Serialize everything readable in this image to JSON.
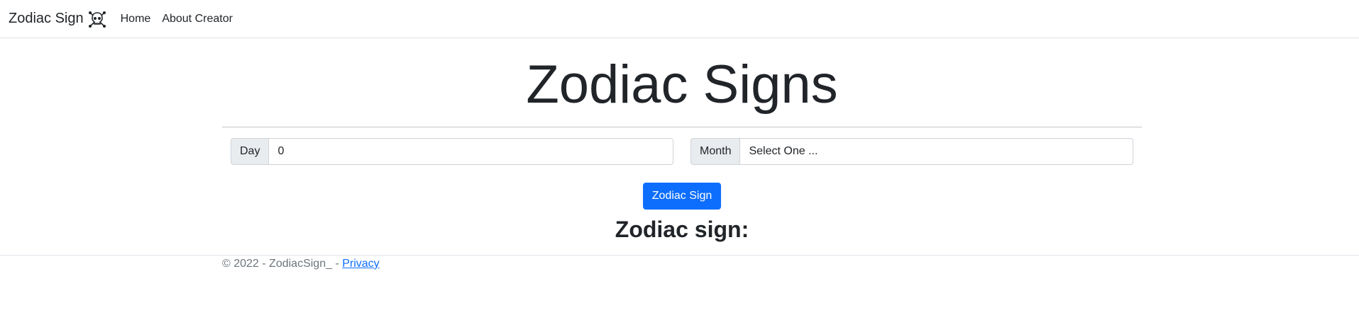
{
  "navbar": {
    "brand": "Zodiac Sign",
    "brand_icon": "skull-crossbones-icon",
    "links": [
      "Home",
      "About Creator"
    ]
  },
  "main": {
    "title": "Zodiac Signs",
    "day": {
      "label": "Day",
      "value": "0"
    },
    "month": {
      "label": "Month",
      "selected": "Select One ..."
    },
    "submit_label": "Zodiac Sign",
    "result_label": "Zodiac sign:"
  },
  "footer": {
    "text": "© 2022 - ZodiacSign_ - ",
    "privacy_link": "Privacy"
  },
  "colors": {
    "primary": "#0d6efd",
    "border": "#ced4da",
    "addon_bg": "#e9ecef"
  }
}
